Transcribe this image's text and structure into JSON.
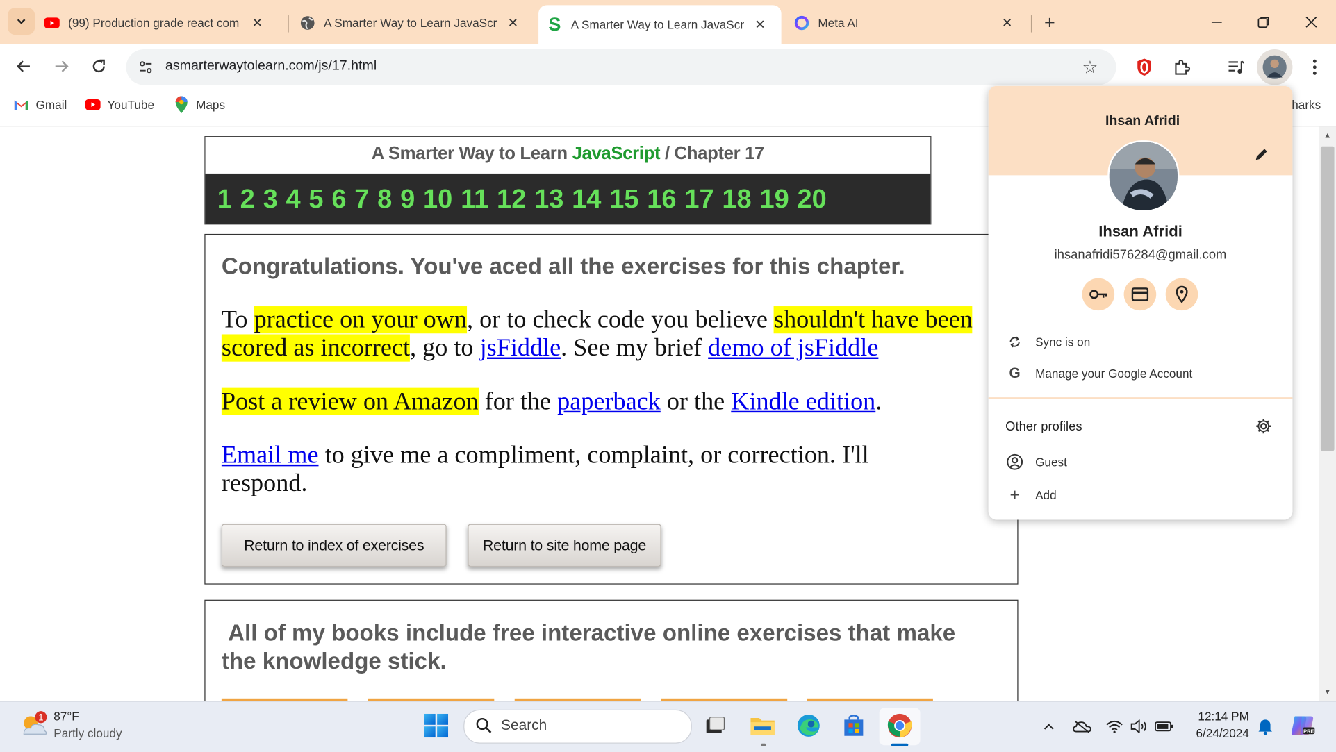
{
  "browser": {
    "tabs": [
      {
        "title": "(99) Production grade react com",
        "icon": "youtube-icon"
      },
      {
        "title": "A Smarter Way to Learn JavaScr",
        "icon": "globe-icon"
      },
      {
        "title": "A Smarter Way to Learn JavaScr",
        "icon": "s-logo-icon"
      },
      {
        "title": "Meta AI",
        "icon": "meta-ai-icon"
      }
    ],
    "active_tab_index": 2,
    "url": "asmarterwaytolearn.com/js/17.html",
    "bookmarks": [
      {
        "label": "Gmail",
        "icon": "gmail-icon"
      },
      {
        "label": "YouTube",
        "icon": "youtube-icon"
      },
      {
        "label": "Maps",
        "icon": "maps-icon"
      }
    ],
    "bookmarks_all_visible": "harks"
  },
  "page": {
    "header_prefix": "A Smarter Way to Learn",
    "header_brand": "JavaScript",
    "header_sep": "/",
    "header_chapter": "Chapter 17",
    "chapters": [
      "1",
      "2",
      "3",
      "4",
      "5",
      "6",
      "7",
      "8",
      "9",
      "10",
      "11",
      "12",
      "13",
      "14",
      "15",
      "16",
      "17",
      "18",
      "19",
      "20"
    ],
    "congrats": "Congratulations. You've aced all the exercises for this chapter.",
    "p1_a": "To ",
    "p1_hl1": "practice on your own",
    "p1_b": ", or to check code you believe ",
    "p1_hl2": "shouldn't have been scored as incorrect",
    "p1_c": ", go to ",
    "p1_link1": "jsFiddle",
    "p1_d": ". See my brief ",
    "p1_link2": "demo of jsFiddle",
    "p2_hl": "Post a review on Amazon",
    "p2_a": " for the ",
    "p2_link1": "paperback",
    "p2_b": " or the ",
    "p2_link2": "Kindle edition",
    "p2_c": ".",
    "p3_link": "Email me",
    "p3_a": " to give me a compliment, complaint, or correction. I'll respond.",
    "btn_index": "Return to index of exercises",
    "btn_home": "Return to site home page",
    "books_title": "All of my books include free interactive online exercises that make the knowledge stick."
  },
  "profile_popup": {
    "name_top": "Ihsan Afridi",
    "name": "Ihsan Afridi",
    "email": "ihsanafridi576284@gmail.com",
    "sync": "Sync is on",
    "manage": "Manage your Google Account",
    "other_profiles": "Other profiles",
    "guest": "Guest",
    "add": "Add"
  },
  "taskbar": {
    "temp": "87°F",
    "weather": "Partly cloudy",
    "weather_badge": "1",
    "search_placeholder": "Search",
    "time": "12:14 PM",
    "date": "6/24/2024"
  }
}
